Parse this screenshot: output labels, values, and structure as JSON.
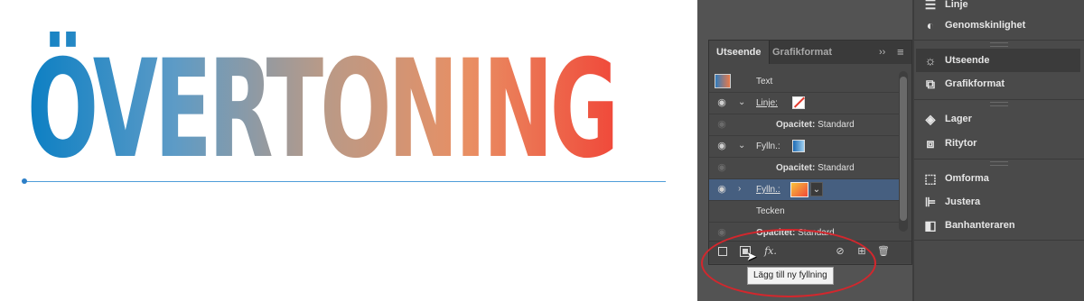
{
  "artwork": {
    "headline": "ÖVERTONING",
    "gradient_colors": [
      "#0b7fc4",
      "#5d9bc6",
      "#b89a88",
      "#e98f63",
      "#f0493a"
    ]
  },
  "appearance_panel": {
    "tabs": [
      {
        "label": "Utseende",
        "active": true
      },
      {
        "label": "Grafikformat",
        "active": false
      }
    ],
    "collapse_glyph": "››",
    "menu_glyph": "≡",
    "rows": [
      {
        "type": "object",
        "label": "Text"
      },
      {
        "type": "stroke",
        "label": "Linje:",
        "expanded": true
      },
      {
        "type": "opacity",
        "key": "Opacitet:",
        "value": "Standard"
      },
      {
        "type": "fill",
        "label": "Fylln.:",
        "expanded": true
      },
      {
        "type": "opacity",
        "key": "Opacitet:",
        "value": "Standard"
      },
      {
        "type": "fill",
        "label": "Fylln.:",
        "expanded": false,
        "selected": true
      },
      {
        "type": "group",
        "label": "Tecken"
      },
      {
        "type": "opacity",
        "key": "Opacitet:",
        "value": "Standard"
      }
    ],
    "bottom_bar": {
      "fx_label": "fx."
    }
  },
  "tooltip": {
    "text": "Lägg till ny fyllning"
  },
  "dock": {
    "items": [
      {
        "label": "Linje",
        "icon": "stroke-lines-icon"
      },
      {
        "label": "Genomskinlighet",
        "icon": "transparency-icon"
      },
      {
        "label": "Utseende",
        "icon": "appearance-sun-icon",
        "active": true
      },
      {
        "label": "Grafikformat",
        "icon": "graphic-styles-icon"
      },
      {
        "label": "Lager",
        "icon": "layers-icon"
      },
      {
        "label": "Ritytor",
        "icon": "artboards-icon"
      },
      {
        "label": "Omforma",
        "icon": "transform-icon"
      },
      {
        "label": "Justera",
        "icon": "align-icon"
      },
      {
        "label": "Banhanteraren",
        "icon": "pathfinder-icon"
      }
    ]
  },
  "highlight_color": "#d3272d",
  "selection_color": "#465f80"
}
